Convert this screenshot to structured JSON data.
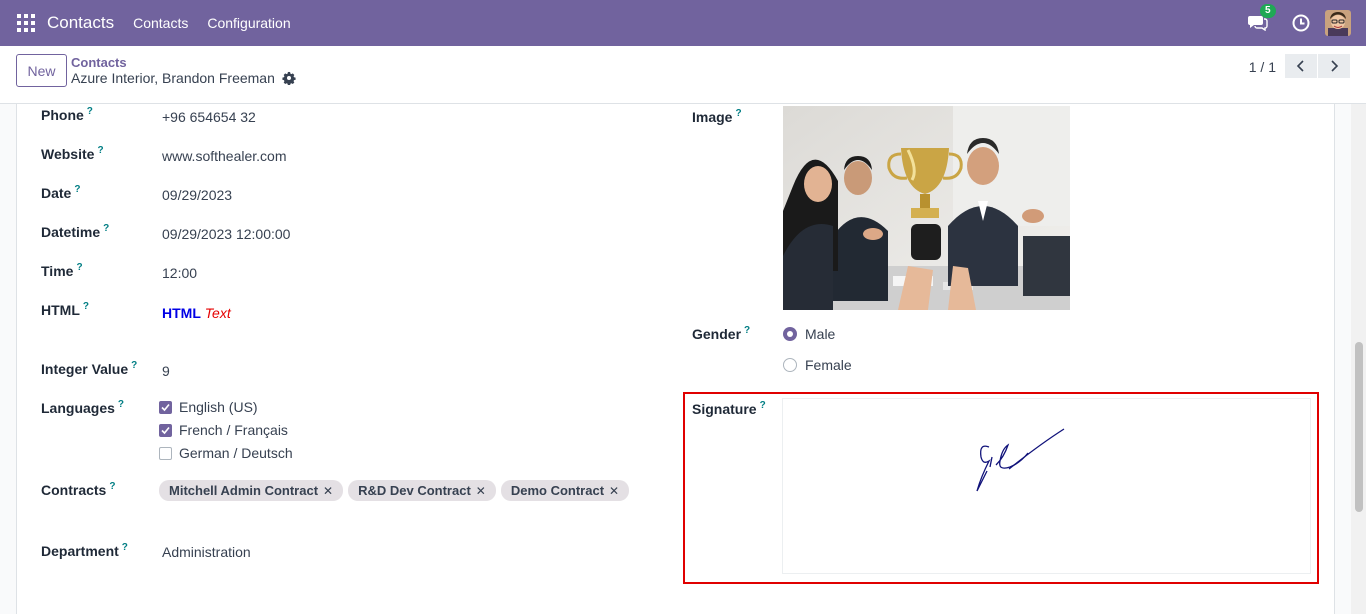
{
  "navbar": {
    "app_name": "Contacts",
    "menus": [
      "Contacts",
      "Configuration"
    ],
    "chat_badge": "5",
    "color": "#71639e"
  },
  "control": {
    "new_label": "New",
    "breadcrumb": "Contacts",
    "record_title": "Azure Interior, Brandon Freeman",
    "pager": "1 / 1"
  },
  "form": {
    "help_mark": "?",
    "phone": {
      "label": "Phone",
      "value": "+96 654654 32"
    },
    "website": {
      "label": "Website",
      "value": "www.softhealer.com"
    },
    "date": {
      "label": "Date",
      "value": "09/29/2023"
    },
    "datetime": {
      "label": "Datetime",
      "value": "09/29/2023 12:00:00"
    },
    "time": {
      "label": "Time",
      "value": "12:00"
    },
    "html": {
      "label": "HTML",
      "bold": "HTML",
      "italic": "Text"
    },
    "integer": {
      "label": "Integer Value",
      "value": "9"
    },
    "languages": {
      "label": "Languages",
      "options": [
        {
          "label": "English (US)",
          "checked": true
        },
        {
          "label": "French / Français",
          "checked": true
        },
        {
          "label": "German / Deutsch",
          "checked": false
        }
      ]
    },
    "contracts": {
      "label": "Contracts",
      "tags": [
        "Mitchell Admin Contract",
        "R&D Dev Contract",
        "Demo Contract"
      ]
    },
    "department": {
      "label": "Department",
      "value": "Administration"
    },
    "image": {
      "label": "Image"
    },
    "gender": {
      "label": "Gender",
      "options": [
        {
          "label": "Male",
          "selected": true
        },
        {
          "label": "Female",
          "selected": false
        }
      ]
    },
    "signature": {
      "label": "Signature"
    }
  }
}
